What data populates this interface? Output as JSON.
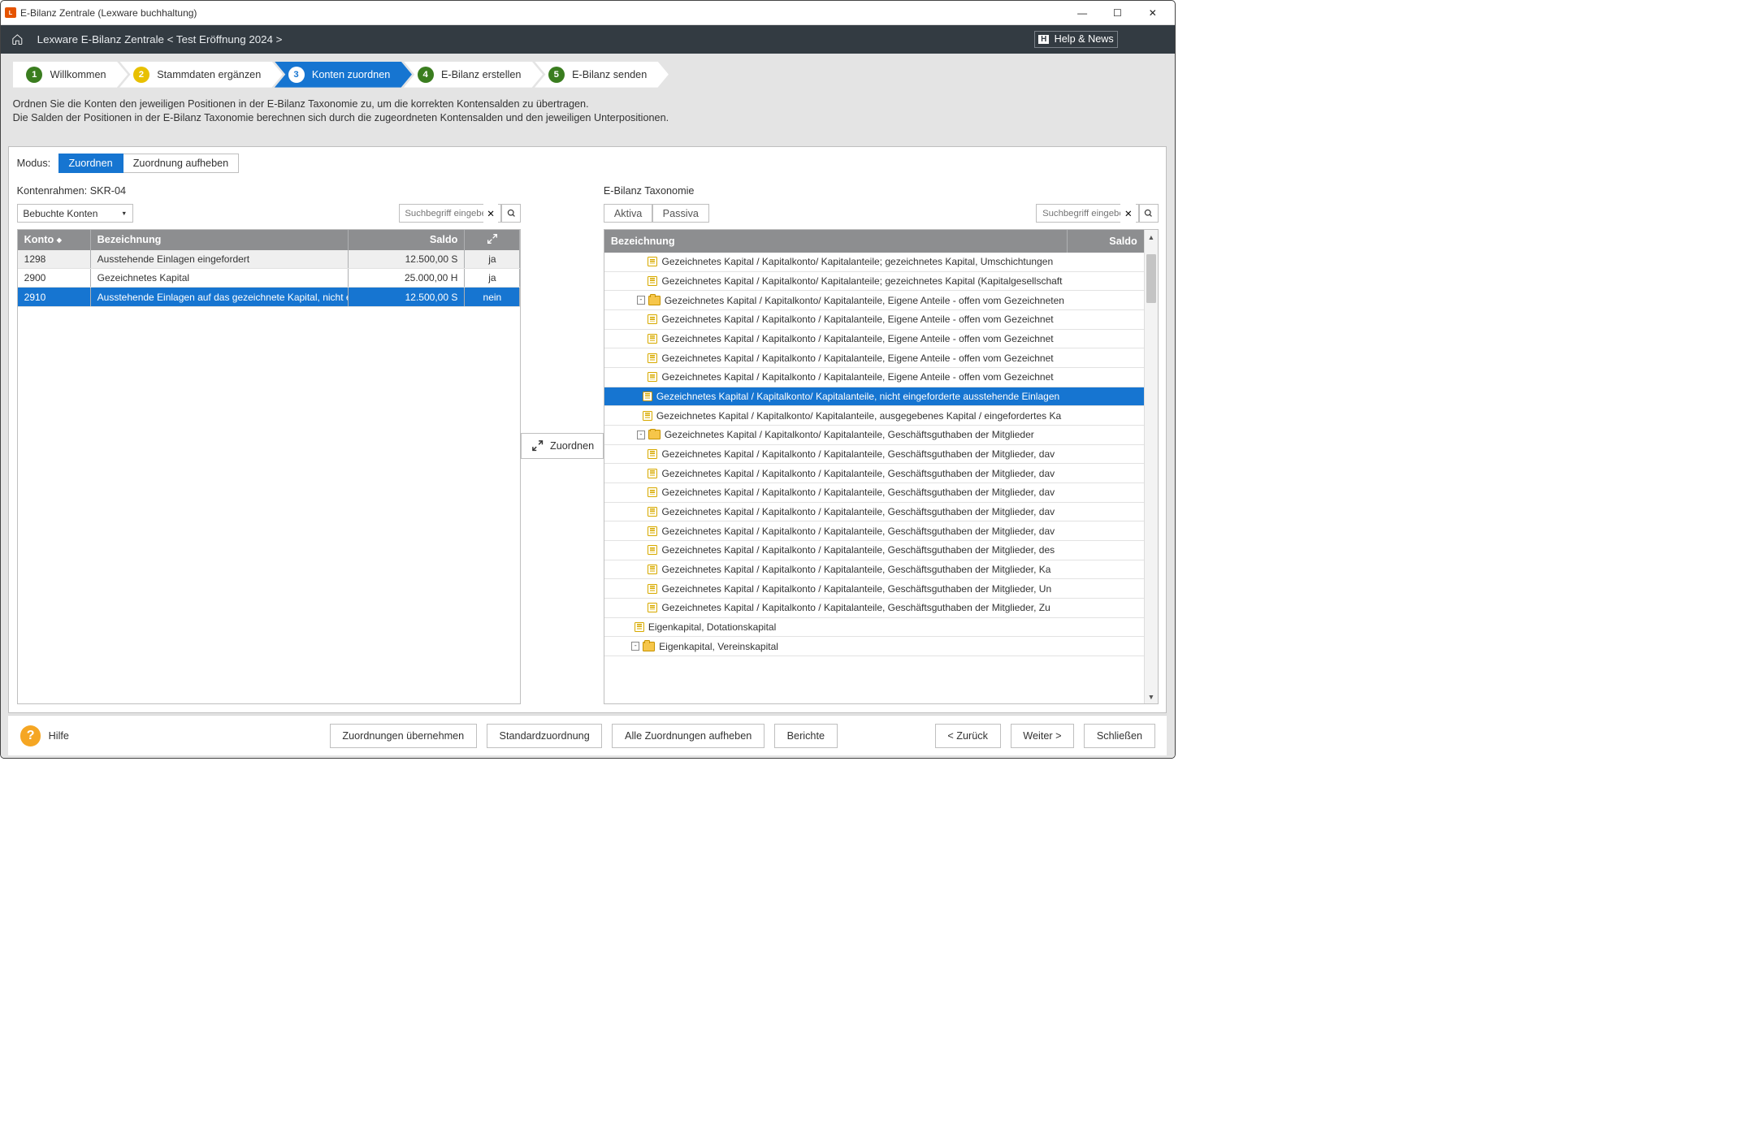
{
  "titlebar": {
    "text": "E-Bilanz Zentrale (Lexware buchhaltung)"
  },
  "header": {
    "breadcrumb": "Lexware E-Bilanz Zentrale < Test Eröffnung 2024 >",
    "help_news": "Help & News"
  },
  "wizard": {
    "steps": [
      {
        "num": "1",
        "label": "Willkommen",
        "badge": "green"
      },
      {
        "num": "2",
        "label": "Stammdaten ergänzen",
        "badge": "yellow"
      },
      {
        "num": "3",
        "label": "Konten zuordnen",
        "badge": "active"
      },
      {
        "num": "4",
        "label": "E-Bilanz erstellen",
        "badge": "green"
      },
      {
        "num": "5",
        "label": "E-Bilanz senden",
        "badge": "green"
      }
    ],
    "desc1": "Ordnen Sie die Konten den jeweiligen Positionen in der E-Bilanz Taxonomie zu, um die korrekten Kontensalden zu übertragen.",
    "desc2": "Die Salden der Positionen in der E-Bilanz Taxonomie berechnen sich durch die zugeordneten Kontensalden und den jeweiligen Unterpositionen."
  },
  "modus": {
    "label": "Modus:",
    "zuordnen": "Zuordnen",
    "aufheben": "Zuordnung aufheben"
  },
  "left": {
    "subtitle": "Kontenrahmen: SKR-04",
    "combo": "Bebuchte Konten",
    "search_ph": "Suchbegriff eingeben...",
    "headers": {
      "konto": "Konto",
      "bez": "Bezeichnung",
      "saldo": "Saldo"
    },
    "rows": [
      {
        "konto": "1298",
        "bez": "Ausstehende Einlagen eingefordert",
        "saldo": "12.500,00 S",
        "flag": "ja",
        "sel": false,
        "alt": true
      },
      {
        "konto": "2900",
        "bez": "Gezeichnetes Kapital",
        "saldo": "25.000,00 H",
        "flag": "ja",
        "sel": false,
        "alt": false
      },
      {
        "konto": "2910",
        "bez": "Ausstehende Einlagen auf das gezeichnete Kapital, nicht eingef",
        "saldo": "12.500,00 S",
        "flag": "nein",
        "sel": true,
        "alt": false
      }
    ]
  },
  "assign_label": "Zuordnen",
  "right": {
    "subtitle": "E-Bilanz Taxonomie",
    "aktiva": "Aktiva",
    "passiva": "Passiva",
    "search_ph": "Suchbegriff eingeben...",
    "headers": {
      "bez": "Bezeichnung",
      "saldo": "Saldo"
    },
    "tree": [
      {
        "indent": 80,
        "icon": "doc",
        "toggle": "",
        "label": "Gezeichnetes Kapital / Kapitalkonto/ Kapitalanteile; gezeichnetes Kapital, Umschichtungen",
        "sel": false
      },
      {
        "indent": 80,
        "icon": "doc",
        "toggle": "",
        "label": "Gezeichnetes Kapital / Kapitalkonto/ Kapitalanteile; gezeichnetes Kapital (Kapitalgesellschaft",
        "sel": false
      },
      {
        "indent": 60,
        "icon": "folder",
        "toggle": "-",
        "label": "Gezeichnetes Kapital / Kapitalkonto/ Kapitalanteile, Eigene Anteile - offen vom Gezeichneten",
        "sel": false
      },
      {
        "indent": 80,
        "icon": "doc",
        "toggle": "",
        "label": "Gezeichnetes Kapital / Kapitalkonto / Kapitalanteile, Eigene Anteile - offen vom Gezeichnet",
        "sel": false
      },
      {
        "indent": 80,
        "icon": "doc",
        "toggle": "",
        "label": "Gezeichnetes Kapital / Kapitalkonto / Kapitalanteile, Eigene Anteile - offen vom Gezeichnet",
        "sel": false
      },
      {
        "indent": 80,
        "icon": "doc",
        "toggle": "",
        "label": "Gezeichnetes Kapital / Kapitalkonto / Kapitalanteile, Eigene Anteile - offen vom Gezeichnet",
        "sel": false
      },
      {
        "indent": 80,
        "icon": "doc",
        "toggle": "",
        "label": "Gezeichnetes Kapital / Kapitalkonto / Kapitalanteile, Eigene Anteile - offen vom Gezeichnet",
        "sel": false
      },
      {
        "indent": 70,
        "icon": "doc",
        "toggle": "",
        "label": "Gezeichnetes Kapital / Kapitalkonto/ Kapitalanteile, nicht eingeforderte ausstehende Einlagen",
        "sel": true
      },
      {
        "indent": 70,
        "icon": "doc",
        "toggle": "",
        "label": "Gezeichnetes Kapital / Kapitalkonto/ Kapitalanteile, ausgegebenes Kapital / eingefordertes Ka",
        "sel": false
      },
      {
        "indent": 60,
        "icon": "folder",
        "toggle": "-",
        "label": "Gezeichnetes Kapital / Kapitalkonto/ Kapitalanteile, Geschäftsguthaben der Mitglieder",
        "sel": false
      },
      {
        "indent": 80,
        "icon": "doc",
        "toggle": "",
        "label": "Gezeichnetes Kapital / Kapitalkonto / Kapitalanteile, Geschäftsguthaben der Mitglieder, dav",
        "sel": false
      },
      {
        "indent": 80,
        "icon": "doc",
        "toggle": "",
        "label": "Gezeichnetes Kapital / Kapitalkonto / Kapitalanteile, Geschäftsguthaben der Mitglieder, dav",
        "sel": false
      },
      {
        "indent": 80,
        "icon": "doc",
        "toggle": "",
        "label": "Gezeichnetes Kapital / Kapitalkonto / Kapitalanteile, Geschäftsguthaben der Mitglieder, dav",
        "sel": false
      },
      {
        "indent": 80,
        "icon": "doc",
        "toggle": "",
        "label": "Gezeichnetes Kapital / Kapitalkonto / Kapitalanteile, Geschäftsguthaben der Mitglieder, dav",
        "sel": false
      },
      {
        "indent": 80,
        "icon": "doc",
        "toggle": "",
        "label": "Gezeichnetes Kapital / Kapitalkonto / Kapitalanteile, Geschäftsguthaben der Mitglieder, dav",
        "sel": false
      },
      {
        "indent": 80,
        "icon": "doc",
        "toggle": "",
        "label": "Gezeichnetes Kapital / Kapitalkonto / Kapitalanteile, Geschäftsguthaben der Mitglieder, des",
        "sel": false
      },
      {
        "indent": 80,
        "icon": "doc",
        "toggle": "",
        "label": "Gezeichnetes Kapital / Kapitalkonto / Kapitalanteile, Geschäftsguthaben der Mitglieder, Ka",
        "sel": false
      },
      {
        "indent": 80,
        "icon": "doc",
        "toggle": "",
        "label": "Gezeichnetes Kapital / Kapitalkonto / Kapitalanteile, Geschäftsguthaben der Mitglieder, Un",
        "sel": false
      },
      {
        "indent": 80,
        "icon": "doc",
        "toggle": "",
        "label": "Gezeichnetes Kapital / Kapitalkonto / Kapitalanteile, Geschäftsguthaben der Mitglieder, Zu",
        "sel": false
      },
      {
        "indent": 55,
        "icon": "doc",
        "toggle": "",
        "label": "Eigenkapital, Dotationskapital",
        "sel": false
      },
      {
        "indent": 50,
        "icon": "folder",
        "toggle": "-",
        "label": "Eigenkapital, Vereinskapital",
        "sel": false
      }
    ]
  },
  "footer": {
    "hilfe": "Hilfe",
    "b1": "Zuordnungen übernehmen",
    "b2": "Standardzuordnung",
    "b3": "Alle Zuordnungen aufheben",
    "b4": "Berichte",
    "back": "< Zurück",
    "next": "Weiter >",
    "close": "Schließen"
  }
}
